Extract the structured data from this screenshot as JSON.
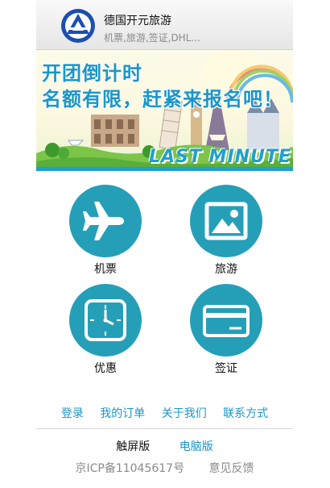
{
  "header": {
    "brand_name": "德国开元旅游",
    "tagline": "机票,旅游,签证,DHL..."
  },
  "banner": {
    "line1": "开团倒计时",
    "line2": "名额有限，赶紧来报名吧！",
    "caption": "LAST MINUTE"
  },
  "menu": {
    "items": [
      {
        "label": "机票",
        "icon": "airplane-icon"
      },
      {
        "label": "旅游",
        "icon": "picture-icon"
      },
      {
        "label": "优惠",
        "icon": "clock-icon"
      },
      {
        "label": "签证",
        "icon": "credit-card-icon"
      }
    ]
  },
  "footer": {
    "links": [
      "登录",
      "我的订单",
      "关于我们",
      "联系方式"
    ],
    "touch_version": "触屏版",
    "pc_version": "电脑版",
    "icp": "京ICP备11045617号",
    "feedback": "意见反馈"
  },
  "colors": {
    "accent": "#259fb8",
    "link": "#1a96c8"
  }
}
